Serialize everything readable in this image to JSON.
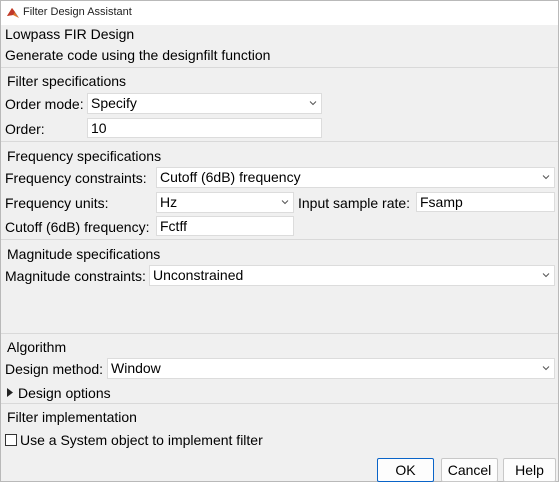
{
  "window": {
    "title": "Filter Design Assistant"
  },
  "header": {
    "title": "Lowpass FIR Design",
    "subtitle": "Generate code using the designfilt function"
  },
  "filter_specs": {
    "heading": "Filter specifications",
    "order_mode_label": "Order mode:",
    "order_mode_value": "Specify",
    "order_label": "Order:",
    "order_value": "10"
  },
  "frequency_specs": {
    "heading": "Frequency specifications",
    "constraints_label": "Frequency constraints:",
    "constraints_value": "Cutoff (6dB) frequency",
    "units_label": "Frequency units:",
    "units_value": "Hz",
    "sample_rate_label": "Input sample rate:",
    "sample_rate_value": "Fsamp",
    "cutoff_label": "Cutoff (6dB) frequency:",
    "cutoff_value": "Fctff"
  },
  "magnitude_specs": {
    "heading": "Magnitude specifications",
    "constraints_label": "Magnitude constraints:",
    "constraints_value": "Unconstrained"
  },
  "algorithm": {
    "heading": "Algorithm",
    "method_label": "Design method:",
    "method_value": "Window",
    "options_label": "Design options"
  },
  "implementation": {
    "heading": "Filter implementation",
    "system_object_label": "Use a System object to implement filter",
    "system_object_checked": false
  },
  "buttons": {
    "ok": "OK",
    "cancel": "Cancel",
    "help": "Help"
  },
  "colors": {
    "primary_border": "#0a64c8",
    "background": "#f0f0f0"
  }
}
